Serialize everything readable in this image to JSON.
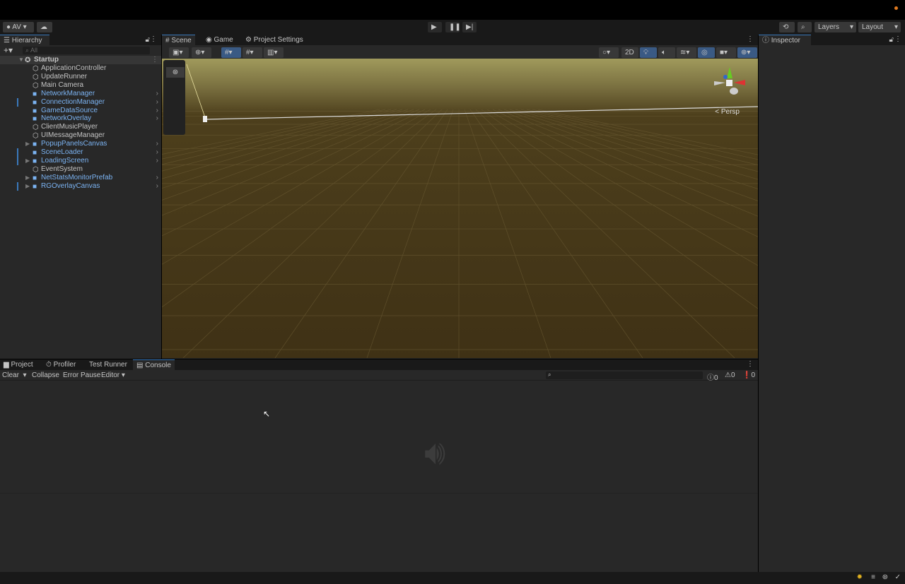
{
  "toolbar": {
    "account": "AV",
    "layers": "Layers",
    "layout": "Layout"
  },
  "hierarchy": {
    "title": "Hierarchy",
    "search_placeholder": "All",
    "scene": "Startup",
    "items": [
      {
        "label": "ApplicationController",
        "prefab": false
      },
      {
        "label": "UpdateRunner",
        "prefab": false
      },
      {
        "label": "Main Camera",
        "prefab": false
      },
      {
        "label": "NetworkManager",
        "prefab": true
      },
      {
        "label": "ConnectionManager",
        "prefab": true
      },
      {
        "label": "GameDataSource",
        "prefab": true
      },
      {
        "label": "NetworkOverlay",
        "prefab": true
      },
      {
        "label": "ClientMusicPlayer",
        "prefab": false
      },
      {
        "label": "UIMessageManager",
        "prefab": false
      },
      {
        "label": "PopupPanelsCanvas",
        "prefab": true
      },
      {
        "label": "SceneLoader",
        "prefab": true
      },
      {
        "label": "LoadingScreen",
        "prefab": true
      },
      {
        "label": "EventSystem",
        "prefab": false
      },
      {
        "label": "NetStatsMonitorPrefab",
        "prefab": true
      },
      {
        "label": "RGOverlayCanvas",
        "prefab": true
      }
    ]
  },
  "center_tabs": [
    "Scene",
    "Game",
    "Project Settings"
  ],
  "scene": {
    "btn_2d": "2D",
    "persp": "< Persp"
  },
  "inspector": {
    "title": "Inspector"
  },
  "bottom_tabs": [
    "Project",
    "Profiler",
    "Test Runner",
    "Console"
  ],
  "console": {
    "clear": "Clear",
    "collapse": "Collapse",
    "error_pause": "Error Pause",
    "editor": "Editor",
    "info_count": "0",
    "warn_count": "0",
    "error_count": "0"
  },
  "colors": {
    "accent": "#3a79bb",
    "prefab": "#7bb3f2"
  }
}
